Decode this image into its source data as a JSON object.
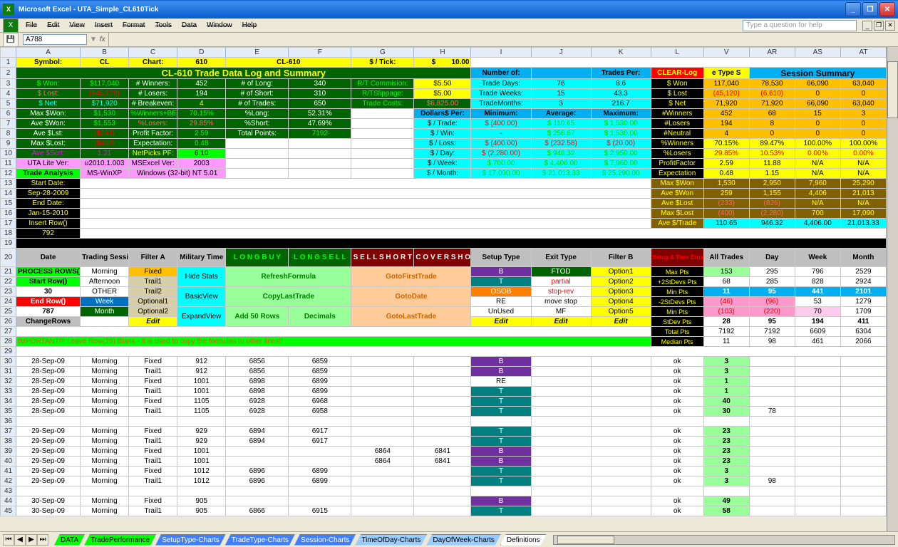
{
  "window": {
    "title": "Microsoft Excel - UTA_Simple_CL610Tick"
  },
  "menu": [
    "File",
    "Edit",
    "View",
    "Insert",
    "Format",
    "Tools",
    "Data",
    "Window",
    "Help"
  ],
  "helpbox": "Type a question for help",
  "namebox": "A788",
  "columns_top": [
    "",
    "A",
    "B",
    "C",
    "D",
    "E",
    "F",
    "G",
    "H",
    "I",
    "J",
    "K",
    "L",
    "V",
    "AR",
    "AS",
    "AT"
  ],
  "row1": {
    "symbol_l": "Symbol:",
    "symbol": "CL",
    "chart_l": "Chart:",
    "chart": "610",
    "combo": "CL-610",
    "pertick_l": "$ / Tick:",
    "pertick_s": "$",
    "pertick": "10.00"
  },
  "summaryTitle": "CL-610 Trade Data Log and Summary",
  "numberOf": "Number of:",
  "tradesPer": "Trades Per:",
  "clear": "CLEAR-Log",
  "typeS": "e Type S",
  "sessSum": "Session Summary",
  "left_block": {
    "swon_l": "$ Won:",
    "swon": "$117,040",
    "swon_r": "",
    "slost_l": "$ Lost:",
    "slost": "($45,120)",
    "slost_e": "",
    "snet_l": "$ Net:",
    "snet": "$71,920",
    "snet_e": "",
    "maxw_l": "Max $Won:",
    "maxw": "$1,530",
    "avew_l": "Ave $Won:",
    "avew": "$1,553",
    "avel_l": "Ave $Lst:",
    "avel": "($233)",
    "maxl_l": "Max $Lost:",
    "maxl": "($400)",
    "aves_l": "Ave $Scrt:",
    "aves": "1.21"
  },
  "mid_block": {
    "win_l": "# Winners:",
    "win": "452",
    "long_l": "# of Long:",
    "long": "340",
    "rtc_l": "R/T Commision:",
    "rtc": "$5.50",
    "los_l": "# Losers:",
    "los": "194",
    "short_l": "# of Short:",
    "short": "310",
    "rts_l": "R/TSlippage:",
    "rts": "$5.00",
    "be_l": "# Breakeven:",
    "be": "4",
    "trd_l": "# of Trades:",
    "trd": "650",
    "tc_l": "Trade Costs:",
    "tc": "$6,825.00",
    "wbe_l": "%Winners+BE:",
    "wbe": "70.15%",
    "plong_l": "%Long:",
    "plong": "52.31%",
    "plos_l": "%Losers:",
    "plos": "29.85%",
    "pshort_l": "%Short:",
    "pshort": "47.69%",
    "pf_l": "Profit Factor:",
    "pf": "2.59",
    "tp_l": "Total Points:",
    "tp": "7192",
    "exp_l": "Expectation:",
    "exp": "0.48",
    "np_l": "NetPicks PF:",
    "np": "6.10"
  },
  "version": {
    "uta_l": "UTA Lite Ver:",
    "uta": "u2010.1.003",
    "xl_l": "MSExcel Ver:",
    "xl": "2003",
    "os_l": "MS-WinXP",
    "os": "Windows (32-bit) NT 5.01"
  },
  "dates": {
    "ta": "Trade Analysis",
    "sd_l": "Start Date:",
    "sd": "Sep-28-2009",
    "ed_l": "End Date:",
    "ed": "Jan-15-2010",
    "ir": "Insert Row()",
    "num": "792"
  },
  "dps": {
    "hdr": "Dollars$ Per:",
    "min": "Minimum:",
    "avg": "Average:",
    "max": "Maximum:",
    "trade_l": "$ / Trade:",
    "t_min": "(400.00)",
    "t_avg": "110.65",
    "t_max": "1,530.00",
    "win_l": "$ / Win:",
    "w_min": "-",
    "w_avg": "256.67",
    "w_max": "1,530.00",
    "loss_l": "$ / Loss:",
    "l_min": "(400.00)",
    "l_avg": "(232.58)",
    "l_max": "(20.00)",
    "day_l": "$ / Day:",
    "d_min": "(2,280.00)",
    "d_avg": "946.32",
    "d_max": "2,950.00",
    "week_l": "$ / Week:",
    "wk_min": "700.00",
    "wk_avg": "4,406.00",
    "wk_max": "7,960.00",
    "month_l": "$ / Month:",
    "mo_min": "17,090.00",
    "mo_avg": "21,013.33",
    "mo_max": "25,290.00"
  },
  "counts": {
    "td_l": "Trade Days:",
    "td": "76",
    "td_r": "8.6",
    "tw_l": "Trade Weeks:",
    "tw": "15",
    "tw_r": "43.3",
    "tm_l": "TradeMonths:",
    "tm": "3",
    "tm_r": "216.7"
  },
  "right": {
    "swon": "$ Won",
    "slost": "$ Lost",
    "snet": "$ Net",
    "nwin": "#Winners",
    "nlos": "#Losers",
    "nneu": "#Neutral",
    "pwin": "%Winners",
    "plos": "%Losers",
    "pf": "ProfitFactor",
    "exp": "Expectation",
    "maxw": "Max $Won",
    "avew": "Ave $Won",
    "avel": "Ave $Lost",
    "maxl": "Max $Lost",
    "avet": "Ave $/Trade",
    "r": [
      [
        "117,040",
        "78,530",
        "66,090",
        "63,040"
      ],
      [
        "(45,120)",
        "(6,610)",
        "0",
        "0"
      ],
      [
        "71,920",
        "71,920",
        "66,090",
        "63,040"
      ],
      [
        "452",
        "68",
        "15",
        "3"
      ],
      [
        "194",
        "8",
        "0",
        "0"
      ],
      [
        "4",
        "0",
        "0",
        "0"
      ],
      [
        "70.15%",
        "89.47%",
        "100.00%",
        "100.00%"
      ],
      [
        "29.85%",
        "10.53%",
        "0.00%",
        "0.00%"
      ],
      [
        "2.59",
        "11.88",
        "N/A",
        "N/A"
      ],
      [
        "0.48",
        "1.15",
        "N/A",
        "N/A"
      ],
      [
        "1,530",
        "2,950",
        "7,960",
        "25,290"
      ],
      [
        "259",
        "1,155",
        "4,406",
        "21,013"
      ],
      [
        "(233)",
        "(826)",
        "N/A",
        "N/A"
      ],
      [
        "(400)",
        "(2,280)",
        "700",
        "17,090"
      ],
      [
        "110.65",
        "946.32",
        "4,406.00",
        "21,013.33"
      ]
    ]
  },
  "section20": {
    "date": "Date",
    "ts": "Trading Session",
    "fa": "Filter A",
    "mt": "Military Time",
    "lb": "L O N G    B U Y",
    "ls": "L O N G    S E L L",
    "ss": "S E L L    S H O R T",
    "cs": "C O V E R    S H O R T",
    "st": "Setup Type",
    "et": "Exit Type",
    "fb": "Filter B",
    "se": "Setup & Time Error Check",
    "at": "All Trades",
    "day": "Day",
    "wk": "Week",
    "mo": "Month"
  },
  "btns": {
    "pr": "PROCESS ROWS()",
    "sr": "Start Row()",
    "n30": "30",
    "er": "End Row()",
    "n787": "787",
    "cr": "ChangeRows",
    "morn": "Morning",
    "aft": "Afternoon",
    "oth": "OTHER",
    "week": "Week",
    "month": "Month",
    "fix": "Fixed",
    "tr1": "Trail1",
    "tr2": "Trail2",
    "op1": "Optional1",
    "op2": "Optional2",
    "edit": "Edit",
    "hs": "Hide Stats",
    "bv": "BasicView",
    "ev": "ExpandView",
    "rf": "RefreshFormula",
    "clt": "CopyLastTrade",
    "a50": "Add 50 Rows",
    "dec": "Decimals",
    "gft": "GotoFirstTrade",
    "gd": "GotoDate",
    "glt": "GotoLastTrade",
    "B": "B",
    "T": "T",
    "OS": "OSOB",
    "RE": "RE",
    "UN": "UnUsed",
    "ftod": "FTOD",
    "par": "partial",
    "srev": "stop-rev",
    "ms": "move stop",
    "mf": "MF",
    "o1": "Option1",
    "o2": "Option2",
    "o3": "Option3",
    "o4": "Option4",
    "o5": "Option5",
    "mxp": "Max Pts",
    "p2s": "+2StDevs Pts",
    "mnp": "Min Pts",
    "m2s": "-2StDevs Pts",
    "sdp": "StDev Pts",
    "tpt": "Total Pts",
    "mdp": "Median Pts"
  },
  "stats": [
    [
      "153",
      "295",
      "796",
      "2529"
    ],
    [
      "68",
      "285",
      "828",
      "2924"
    ],
    [
      "11",
      "95",
      "441",
      "2101"
    ],
    [
      "(46)",
      "(96)",
      "53",
      "1279"
    ],
    [
      "(103)",
      "(220)",
      "70",
      "1709"
    ],
    [
      "28",
      "95",
      "194",
      "411"
    ],
    [
      "7192",
      "7192",
      "6609",
      "6304"
    ],
    [
      "11",
      "98",
      "461",
      "2066"
    ]
  ],
  "important": "IMPORTANT!!!   Leave Row(29) Blank - It is used to copy the formulas to other lines!!",
  "data_rows": [
    {
      "r": 30,
      "dt": "28-Sep-09",
      "ts": "Morning",
      "fa": "Fixed",
      "mt": "912",
      "lb": "6856",
      "ls": "6859",
      "ss": "",
      "cs": "",
      "st": "B",
      "ok": "ok",
      "at": "3"
    },
    {
      "r": 31,
      "dt": "28-Sep-09",
      "ts": "Morning",
      "fa": "Trail1",
      "mt": "912",
      "lb": "6856",
      "ls": "6859",
      "ss": "",
      "cs": "",
      "st": "B",
      "ok": "ok",
      "at": "3"
    },
    {
      "r": 32,
      "dt": "28-Sep-09",
      "ts": "Morning",
      "fa": "Fixed",
      "mt": "1001",
      "lb": "6898",
      "ls": "6899",
      "ss": "",
      "cs": "",
      "st": "RE",
      "ok": "ok",
      "at": "1"
    },
    {
      "r": 33,
      "dt": "28-Sep-09",
      "ts": "Morning",
      "fa": "Trail1",
      "mt": "1001",
      "lb": "6898",
      "ls": "6899",
      "ss": "",
      "cs": "",
      "st": "T",
      "ok": "ok",
      "at": "1"
    },
    {
      "r": 34,
      "dt": "28-Sep-09",
      "ts": "Morning",
      "fa": "Fixed",
      "mt": "1105",
      "lb": "6928",
      "ls": "6968",
      "ss": "",
      "cs": "",
      "st": "T",
      "ok": "ok",
      "at": "40"
    },
    {
      "r": 35,
      "dt": "28-Sep-09",
      "ts": "Morning",
      "fa": "Trail1",
      "mt": "1105",
      "lb": "6928",
      "ls": "6958",
      "ss": "",
      "cs": "",
      "st": "T",
      "ok": "ok",
      "at": "30",
      "day": "78"
    },
    {
      "r": 36,
      "dt": "",
      "ts": "",
      "fa": "",
      "mt": "",
      "lb": "",
      "ls": "",
      "ss": "",
      "cs": "",
      "st": "",
      "ok": "",
      "at": ""
    },
    {
      "r": 37,
      "dt": "29-Sep-09",
      "ts": "Morning",
      "fa": "Fixed",
      "mt": "929",
      "lb": "6894",
      "ls": "6917",
      "ss": "",
      "cs": "",
      "st": "T",
      "ok": "ok",
      "at": "23"
    },
    {
      "r": 38,
      "dt": "29-Sep-09",
      "ts": "Morning",
      "fa": "Trail1",
      "mt": "929",
      "lb": "6894",
      "ls": "6917",
      "ss": "",
      "cs": "",
      "st": "T",
      "ok": "ok",
      "at": "23"
    },
    {
      "r": 39,
      "dt": "29-Sep-09",
      "ts": "Morning",
      "fa": "Fixed",
      "mt": "1001",
      "lb": "",
      "ls": "",
      "ss": "6864",
      "cs": "6841",
      "st": "B",
      "ok": "ok",
      "at": "23"
    },
    {
      "r": 40,
      "dt": "29-Sep-09",
      "ts": "Morning",
      "fa": "Trail1",
      "mt": "1001",
      "lb": "",
      "ls": "",
      "ss": "6864",
      "cs": "6841",
      "st": "B",
      "ok": "ok",
      "at": "23"
    },
    {
      "r": 41,
      "dt": "29-Sep-09",
      "ts": "Morning",
      "fa": "Fixed",
      "mt": "1012",
      "lb": "6896",
      "ls": "6899",
      "ss": "",
      "cs": "",
      "st": "T",
      "ok": "ok",
      "at": "3"
    },
    {
      "r": 42,
      "dt": "29-Sep-09",
      "ts": "Morning",
      "fa": "Trail1",
      "mt": "1012",
      "lb": "6896",
      "ls": "6899",
      "ss": "",
      "cs": "",
      "st": "T",
      "ok": "ok",
      "at": "3",
      "day": "98"
    },
    {
      "r": 43,
      "dt": "",
      "ts": "",
      "fa": "",
      "mt": "",
      "lb": "",
      "ls": "",
      "ss": "",
      "cs": "",
      "st": "",
      "ok": "",
      "at": ""
    },
    {
      "r": 44,
      "dt": "30-Sep-09",
      "ts": "Morning",
      "fa": "Fixed",
      "mt": "905",
      "lb": "",
      "ls": "",
      "ss": "",
      "cs": "",
      "st": "B",
      "ok": "ok",
      "at": "49"
    },
    {
      "r": 45,
      "dt": "30-Sep-09",
      "ts": "Morning",
      "fa": "Trail1",
      "mt": "905",
      "lb": "6866",
      "ls": "6915",
      "ss": "",
      "cs": "",
      "st": "T",
      "ok": "ok",
      "at": "58"
    }
  ],
  "tabs": [
    "DATA",
    "TradePerformance",
    "SetupType-Charts",
    "TradeType-Charts",
    "Session-Charts",
    "TimeOfDay-Charts",
    "DayOfWeek-Charts",
    "Definitions"
  ]
}
